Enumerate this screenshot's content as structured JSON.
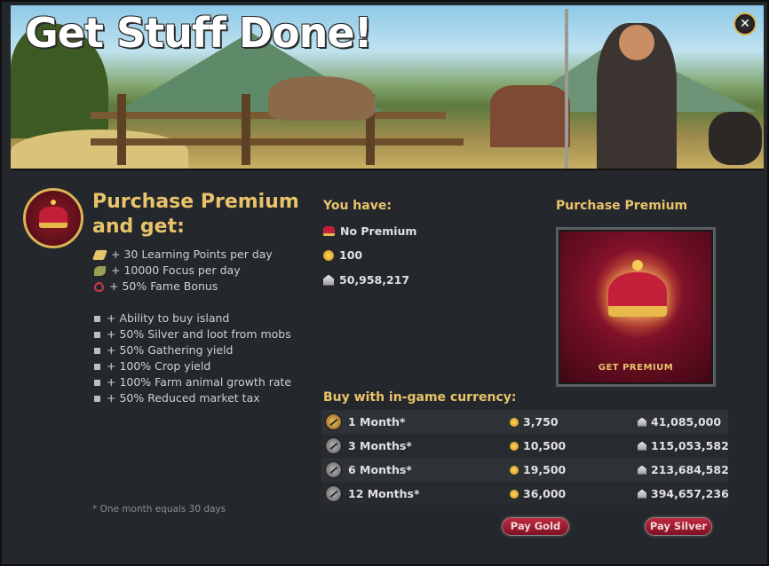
{
  "banner": {
    "title": "Get Stuff Done!",
    "close_label": "✕"
  },
  "left": {
    "heading": "Purchase Premium and get:",
    "bonuses": [
      {
        "icon": "learning-points-icon",
        "text": "+ 30 Learning Points per day"
      },
      {
        "icon": "focus-icon",
        "text": "+ 10000 Focus per day"
      },
      {
        "icon": "fame-icon",
        "text": "+ 50% Fame Bonus"
      }
    ],
    "features": [
      "+ Ability to buy island",
      "+ 50% Silver and loot from mobs",
      "+ 50% Gathering yield",
      "+ 100% Crop yield",
      "+ 100% Farm animal growth rate",
      "+ 50% Reduced market tax"
    ],
    "footnote": "* One month equals 30 days"
  },
  "you_have": {
    "title": "You have:",
    "premium_status": "No Premium",
    "gold": "100",
    "silver": "50,958,217"
  },
  "purchase_premium": {
    "title": "Purchase Premium",
    "button_label": "GET PREMIUM"
  },
  "buy": {
    "title": "Buy with in-game currency:",
    "rows": [
      {
        "label": "1 Month*",
        "gold": "3,750",
        "silver": "41,085,000"
      },
      {
        "label": "3 Months*",
        "gold": "10,500",
        "silver": "115,053,582"
      },
      {
        "label": "6 Months*",
        "gold": "19,500",
        "silver": "213,684,582"
      },
      {
        "label": "12 Months*",
        "gold": "36,000",
        "silver": "394,657,236"
      }
    ],
    "pay_gold_label": "Pay Gold",
    "pay_silver_label": "Pay Silver"
  },
  "colors": {
    "accent_gold": "#e8c36a",
    "button_red": "#c22b43",
    "panel_bg": "#24272b"
  }
}
